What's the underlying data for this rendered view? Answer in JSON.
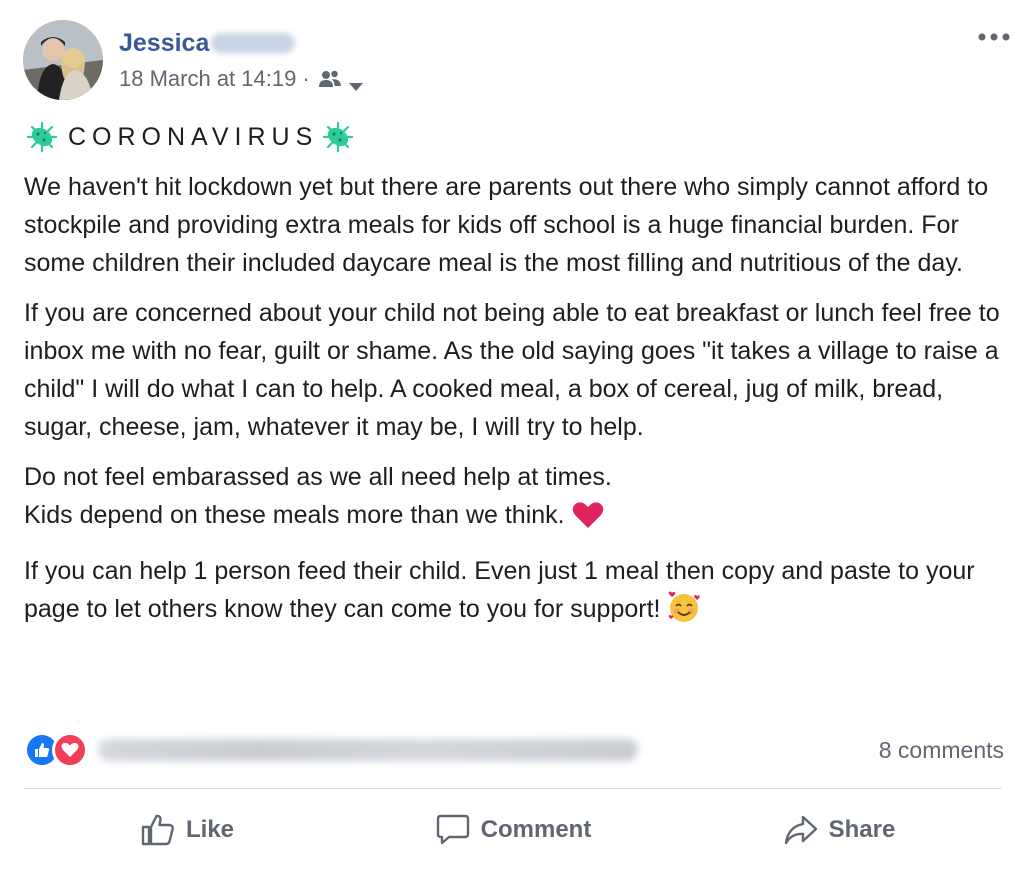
{
  "post": {
    "author": "Jessica",
    "timestamp": "18 March at 14:19",
    "separator": "·",
    "title": "CORONAVIRUS",
    "paragraphs": [
      "We haven't hit lockdown yet but there are parents out there who simply cannot afford to stockpile and providing extra meals for kids off school is a huge financial burden. For some children their included daycare meal is the most filling and nutritious of the day.",
      "If you are concerned about your child not being able to eat breakfast or lunch feel free to inbox me with no fear, guilt or shame. As the old saying goes \"it takes a village to raise a child\" I will do what I can to help. A cooked meal, a box of cereal, jug of milk, bread, sugar, cheese, jam, whatever it may be, I will try to help.",
      "Do not feel embarassed as we all need help at times.",
      "Kids depend on these meals more than we think.",
      "If you can help 1 person feed their child. Even just 1 meal then copy and paste to your page to let others know they can come to you for support!"
    ]
  },
  "reactions": {
    "types": [
      "like",
      "love"
    ],
    "comments": "8 comments"
  },
  "actions": {
    "like": "Like",
    "comment": "Comment",
    "share": "Share"
  },
  "icons": {
    "audience": "friends-icon",
    "more": "more-options-icon",
    "virus": "virus-emoji"
  },
  "colors": {
    "author": "#385898",
    "meta": "#606770",
    "like": "#1877f2",
    "love": "#f33e58",
    "virus": "#2ecc9a"
  }
}
